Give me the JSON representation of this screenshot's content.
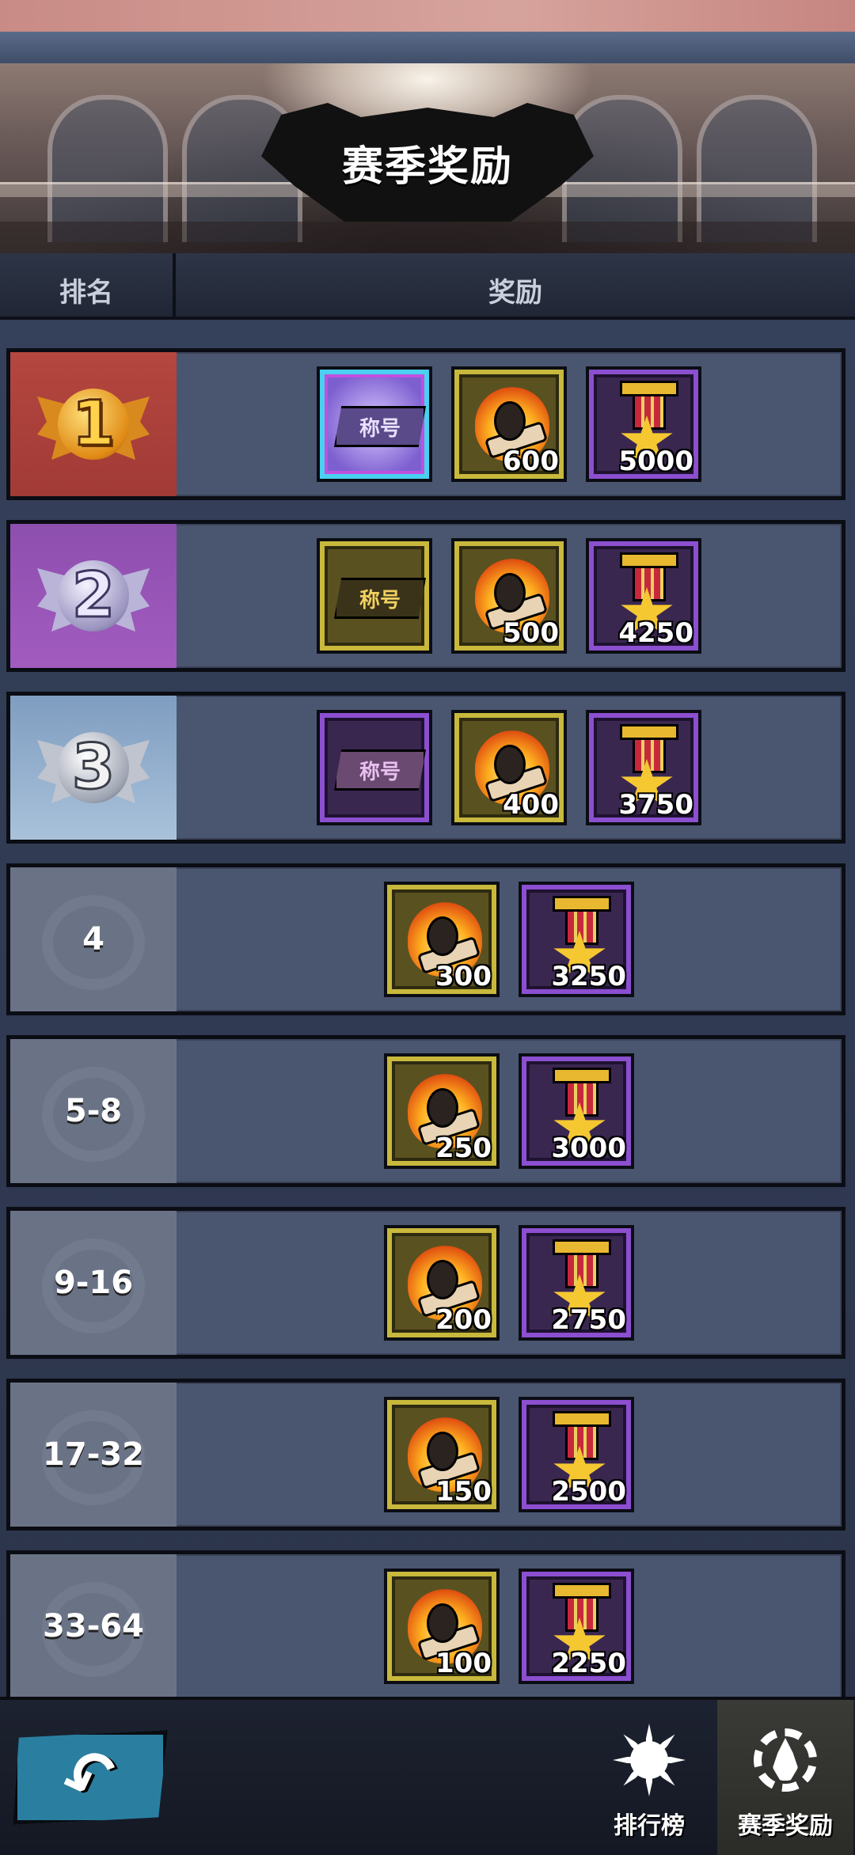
{
  "header": {
    "title": "赛季奖励"
  },
  "columns": {
    "rank": "排名",
    "reward": "奖励"
  },
  "rows": [
    {
      "rank": "1",
      "badge": "gold-medal",
      "rewards": [
        {
          "icon": "title-badge-rainbow",
          "label": "称号",
          "qty": ""
        },
        {
          "icon": "flaming-fist",
          "label": "",
          "qty": "600"
        },
        {
          "icon": "star-medal",
          "label": "",
          "qty": "5000"
        }
      ]
    },
    {
      "rank": "2",
      "badge": "silver-purple-medal",
      "rewards": [
        {
          "icon": "title-badge-gold",
          "label": "称号",
          "qty": ""
        },
        {
          "icon": "flaming-fist",
          "label": "",
          "qty": "500"
        },
        {
          "icon": "star-medal",
          "label": "",
          "qty": "4250"
        }
      ]
    },
    {
      "rank": "3",
      "badge": "silver-medal",
      "rewards": [
        {
          "icon": "title-badge-purple",
          "label": "称号",
          "qty": ""
        },
        {
          "icon": "flaming-fist",
          "label": "",
          "qty": "400"
        },
        {
          "icon": "star-medal",
          "label": "",
          "qty": "3750"
        }
      ]
    },
    {
      "rank": "4",
      "rewards": [
        {
          "icon": "flaming-fist",
          "qty": "300"
        },
        {
          "icon": "star-medal",
          "qty": "3250"
        }
      ]
    },
    {
      "rank": "5-8",
      "rewards": [
        {
          "icon": "flaming-fist",
          "qty": "250"
        },
        {
          "icon": "star-medal",
          "qty": "3000"
        }
      ]
    },
    {
      "rank": "9-16",
      "rewards": [
        {
          "icon": "flaming-fist",
          "qty": "200"
        },
        {
          "icon": "star-medal",
          "qty": "2750"
        }
      ]
    },
    {
      "rank": "17-32",
      "rewards": [
        {
          "icon": "flaming-fist",
          "qty": "150"
        },
        {
          "icon": "star-medal",
          "qty": "2500"
        }
      ]
    },
    {
      "rank": "33-64",
      "rewards": [
        {
          "icon": "flaming-fist",
          "qty": "100"
        },
        {
          "icon": "star-medal",
          "qty": "2250"
        }
      ]
    }
  ],
  "bottom_bar": {
    "back_icon": "back-arrow-icon",
    "tabs": [
      {
        "label": "排行榜",
        "icon": "sun-icon",
        "selected": false
      },
      {
        "label": "赛季奖励",
        "icon": "flame-gear-icon",
        "selected": true
      }
    ]
  },
  "colors": {
    "rank1": "#b4473f",
    "rank2": "#9a56b8",
    "rank3": "#95b1d0",
    "row_bg": "#4a5670",
    "gold_frame": "#c8b83c",
    "purple_frame": "#8b4fd0",
    "back_button": "#2a7fa0"
  }
}
